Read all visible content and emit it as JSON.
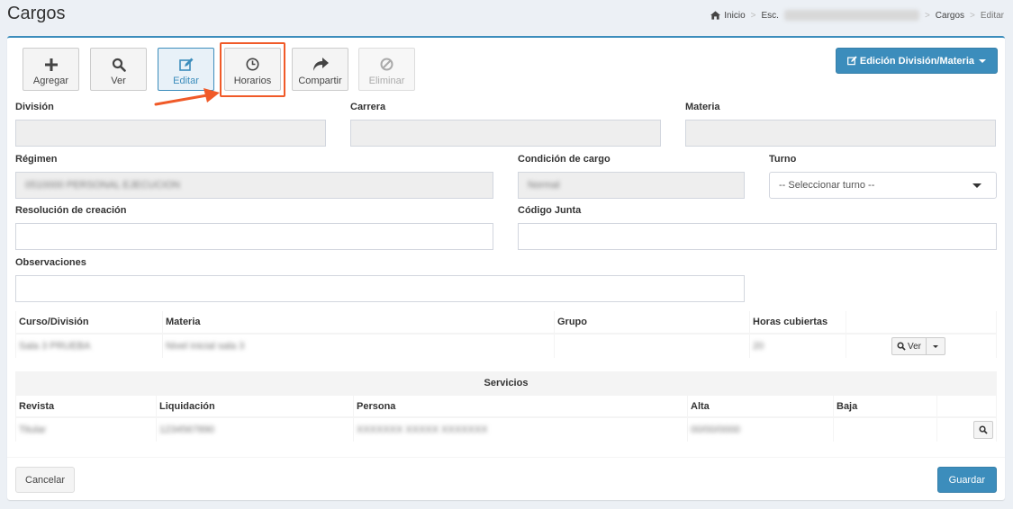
{
  "header": {
    "title": "Cargos",
    "breadcrumb": {
      "home": "Inicio",
      "school": "Esc.",
      "section": "Cargos",
      "current": "Editar"
    }
  },
  "toolbar": {
    "add": "Agregar",
    "view": "Ver",
    "edit": "Editar",
    "schedule": "Horarios",
    "share": "Compartir",
    "delete": "Eliminar",
    "division_menu": "Edición División/Materia"
  },
  "form": {
    "division_label": "División",
    "carrera_label": "Carrera",
    "materia_label": "Materia",
    "regimen_label": "Régimen",
    "regimen_value": "0510000 PERSONAL EJECUCION",
    "condicion_label": "Condición de cargo",
    "condicion_value": "Normal",
    "turno_label": "Turno",
    "turno_placeholder": "-- Seleccionar turno --",
    "resolucion_label": "Resolución de creación",
    "codigo_label": "Código Junta",
    "observaciones_label": "Observaciones"
  },
  "courses_table": {
    "headers": [
      "Curso/División",
      "Materia",
      "Grupo",
      "Horas cubiertas"
    ],
    "rows": [
      {
        "curso": "Sala 3 PRUEBA",
        "materia": "Nivel inicial sala 3",
        "grupo": "",
        "horas": "20",
        "action": "Ver"
      }
    ]
  },
  "services_table": {
    "title": "Servicios",
    "headers": [
      "Revista",
      "Liquidación",
      "Persona",
      "Alta",
      "Baja"
    ],
    "rows": [
      {
        "revista": "Titular",
        "liquidacion": "1234567890",
        "persona": "XXXXXXX XXXXX XXXXXXX",
        "alta": "00/00/0000",
        "baja": ""
      }
    ]
  },
  "footer": {
    "cancel": "Cancelar",
    "save": "Guardar"
  },
  "colors": {
    "primary": "#3c8dbc",
    "annotation": "#f05a28"
  }
}
